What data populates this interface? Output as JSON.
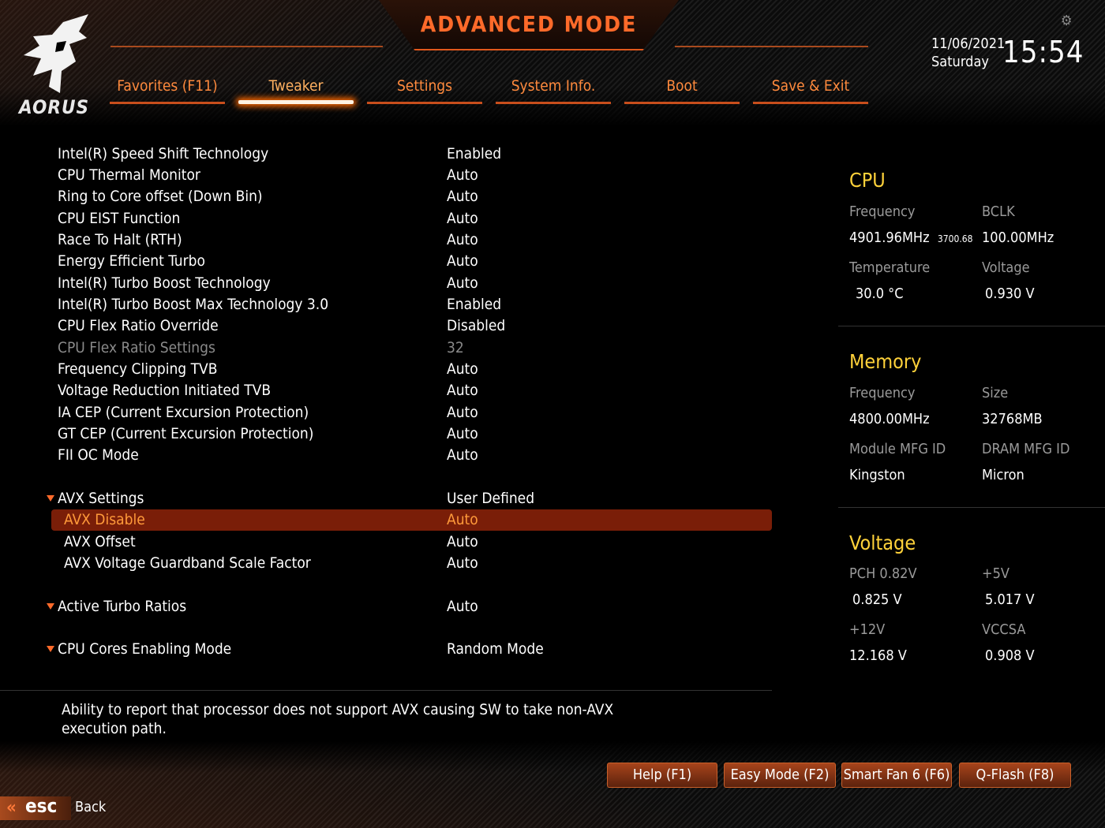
{
  "brand": {
    "logo_text": "AORUS"
  },
  "header": {
    "mode_title": "ADVANCED MODE",
    "date": "11/06/2021",
    "day": "Saturday",
    "time": "15:54",
    "tabs": [
      {
        "label": "Favorites (F11)",
        "active": false
      },
      {
        "label": "Tweaker",
        "active": true
      },
      {
        "label": "Settings",
        "active": false
      },
      {
        "label": "System Info.",
        "active": false
      },
      {
        "label": "Boot",
        "active": false
      },
      {
        "label": "Save & Exit",
        "active": false
      }
    ]
  },
  "settings": [
    {
      "name": "Intel(R) Speed Shift Technology",
      "value": "Enabled"
    },
    {
      "name": "CPU Thermal Monitor",
      "value": "Auto"
    },
    {
      "name": "Ring to Core offset (Down Bin)",
      "value": "Auto"
    },
    {
      "name": "CPU EIST Function",
      "value": "Auto"
    },
    {
      "name": "Race To Halt (RTH)",
      "value": "Auto"
    },
    {
      "name": "Energy Efficient Turbo",
      "value": "Auto"
    },
    {
      "name": "Intel(R) Turbo Boost Technology",
      "value": "Auto"
    },
    {
      "name": "Intel(R) Turbo Boost Max Technology 3.0",
      "value": "Enabled"
    },
    {
      "name": "CPU Flex Ratio Override",
      "value": "Disabled"
    },
    {
      "name": "CPU Flex Ratio Settings",
      "value": "32",
      "disabled": true
    },
    {
      "name": "Frequency Clipping TVB",
      "value": "Auto"
    },
    {
      "name": "Voltage Reduction Initiated TVB",
      "value": "Auto"
    },
    {
      "name": "IA CEP (Current Excursion Protection)",
      "value": "Auto"
    },
    {
      "name": "GT CEP (Current Excursion Protection)",
      "value": "Auto"
    },
    {
      "name": "FII OC Mode",
      "value": "Auto"
    },
    {
      "name": "AVX Settings",
      "value": "User Defined",
      "expandable": true
    },
    {
      "name": "AVX Disable",
      "value": "Auto",
      "selected": true,
      "sub": true
    },
    {
      "name": "AVX Offset",
      "value": "Auto",
      "sub": true
    },
    {
      "name": "AVX Voltage Guardband Scale Factor",
      "value": "Auto",
      "sub": true
    },
    {
      "name": "Active Turbo Ratios",
      "value": "Auto",
      "expandable": true
    },
    {
      "name": "CPU Cores Enabling Mode",
      "value": "Random Mode",
      "expandable": true
    }
  ],
  "help_text": "Ability to report that processor does not support AVX causing SW to take non-AVX execution path.",
  "cpu": {
    "title": "CPU",
    "frequency_label": "Frequency",
    "frequency": "4901.96MHz",
    "frequency_sub": "3700.68",
    "bclk_label": "BCLK",
    "bclk": "100.00MHz",
    "temperature_label": "Temperature",
    "temperature": "30.0 °C",
    "voltage_label": "Voltage",
    "voltage": "0.930 V"
  },
  "memory": {
    "title": "Memory",
    "frequency_label": "Frequency",
    "frequency": "4800.00MHz",
    "size_label": "Size",
    "size": "32768MB",
    "module_label": "Module MFG ID",
    "module": "Kingston",
    "dram_label": "DRAM MFG ID",
    "dram": "Micron"
  },
  "voltage": {
    "title": "Voltage",
    "pch_label": "PCH 0.82V",
    "pch": "0.825 V",
    "p5v_label": "+5V",
    "p5v": "5.017 V",
    "p12v_label": "+12V",
    "p12v": "12.168 V",
    "vccsa_label": "VCCSA",
    "vccsa": "0.908 V"
  },
  "footer": {
    "buttons": [
      "Help (F1)",
      "Easy Mode (F2)",
      "Smart Fan 6 (F6)",
      "Q-Flash (F8)"
    ],
    "esc_label": "esc",
    "back_label": "Back"
  }
}
